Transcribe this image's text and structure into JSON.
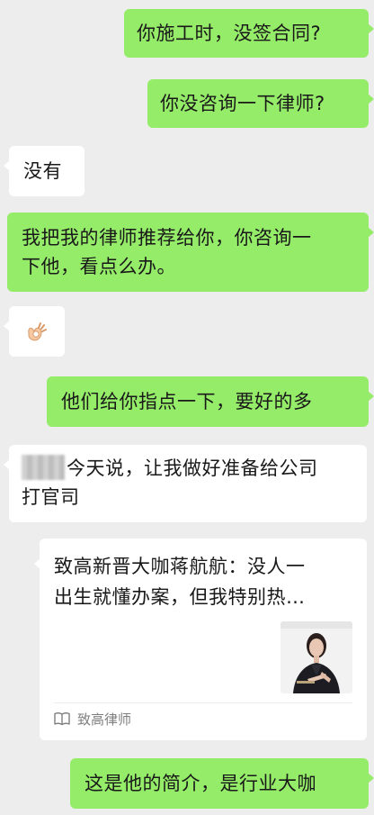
{
  "chat": {
    "messages": [
      {
        "side": "right",
        "text": "你施工时，没签合同?"
      },
      {
        "side": "right",
        "text": "你没咨询一下律师?"
      },
      {
        "side": "left",
        "text": "没有"
      },
      {
        "side": "right",
        "line1": "我把我的律师推荐给你，你咨询一",
        "line2": "下他，看点么办。"
      },
      {
        "side": "left",
        "emoji": "ok-hand"
      },
      {
        "side": "right",
        "text": "他们给你指点一下，要好的多"
      },
      {
        "side": "left",
        "line1": "今天说，让我做好准备给公司",
        "line2": "打官司"
      },
      {
        "side": "right",
        "text": "这是他的简介，是行业大咖"
      }
    ],
    "article_card": {
      "title_line1": "致高新晋大咖蒋航航：没人一",
      "title_line2": "出生就懂办案，但我特别热…",
      "source": "致高律师",
      "source_icon": "book-icon"
    }
  },
  "colors": {
    "background": "#ededed",
    "outgoing_bubble": "#95ec69",
    "incoming_bubble": "#ffffff",
    "text": "#191919",
    "secondary_text": "#7f7f7f"
  }
}
